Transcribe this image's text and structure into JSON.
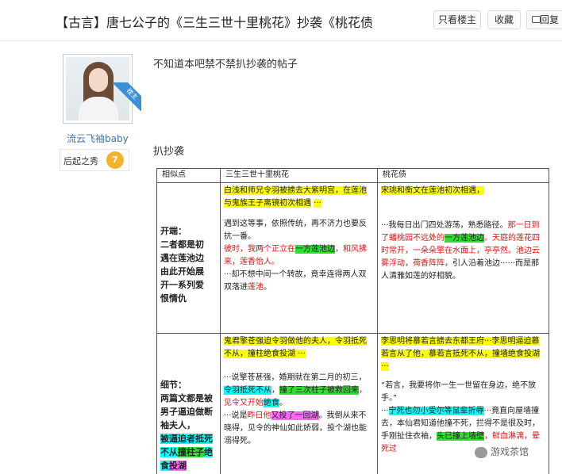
{
  "header": {
    "title": "【古言】唐七公子的《三生三世十里桃花》抄袭《桃花债...",
    "btn_only_op": "只看楼主",
    "btn_fav": "收藏",
    "btn_reply": "回复"
  },
  "user": {
    "ribbon": "楼主",
    "name": "流云飞袖baby",
    "rank": "后起之秀",
    "level": "7"
  },
  "post": {
    "line1": "不知道本吧禁不禁扒抄袭的帖子",
    "line2": "扒抄袭"
  },
  "table": {
    "headers": [
      "相似点",
      "三生三世十里桃花",
      "桃花债"
    ],
    "r1_label": [
      "开端：",
      "二者都是初",
      "遇在莲池边",
      "由此开始展",
      "开一系列爱",
      "恨情仇"
    ],
    "r1_c2_a": "白浅和师兄令羽被掳去大紫明宫，在莲池与鬼族王子离镜初次相遇",
    "r1_c2_a_end": "···",
    "r1_c2_b": "遇到这等事，依照传统，再不济力也要反抗一番。",
    "r1_c2_c1": "彼时，我两个正立在",
    "r1_c2_c2": "一方莲池边",
    "r1_c2_c3": "，和风拂来，莲香怡人。",
    "r1_c2_d1": "···却不想中间一个转故，竟幸连得两人双双落进",
    "r1_c2_d2": "莲池",
    "r1_c2_d3": "。",
    "r1_c3_a": "宋珧和衡文在莲池初次相遇，",
    "r1_c3_b1": "···我每日出门四处游荡，熟悉路径。",
    "r1_c3_b2": "那一日到了蟠桃园不远处的",
    "r1_c3_b3": "一方莲池边",
    "r1_c3_b4": "。天庭的莲花四时常开，一朵朵擎在水面上，亭亭然。池边云雾浮动，荷香阵阵，",
    "r1_c3_b5": "引人沿着池边······而是那人清雅如莲的好相貌。",
    "r2_label1": "细节：",
    "r2_label2": "两篇文都是被男子逼迫做断袖夫人，",
    "r2_label3": "被逼迫者抵死不从",
    "r2_label4": "撞柱",
    "r2_label5": "子",
    "r2_label6": "绝食",
    "r2_label7": "投湖",
    "r2_c2_a": "鬼君擎苍强迫令羽做他的夫人，令羽抵死不从，撞柱绝食投湖 ···",
    "r2_c2_b1": "···说擎苍甚强，婚期就在第二月的初三，",
    "r2_c2_b2": "令羽抵死不从",
    "r2_c2_b3": "，",
    "r2_c2_b4": "撞了三次柱子被救回来",
    "r2_c2_b5": "，见令又开始",
    "r2_c2_b6": "绝食",
    "r2_c2_b7": "。",
    "r2_c2_c1": "···说是",
    "r2_c2_c2": "昨日他",
    "r2_c2_c3": "又投了一回湖",
    "r2_c2_c4": "。我倒从来不晓得，见令的神仙如此娇弱，投个湖也能溺得死。",
    "r2_c3_a": "李思明将慕若言掳去东都王府···李思明逼迫慕若言从了他，慕若言抵死不从，撞墙绝食投湖 ···",
    "r2_c3_b": "“若言，我要将你一生一世留在身边，绝不放手。”",
    "r2_c3_c1": "···",
    "r2_c3_c2": "宁死也勿小受尔等鼠辈折辱",
    "r2_c3_c3": "···竟直向屋墙撞去，本仙君知道他撞不死，拦得不是很及时，手刚扯住衣袖，",
    "r2_c3_c4": "头已撞上墙壁",
    "r2_c3_c5": "，鲜血淋漓，晕死过"
  },
  "watermark": "游戏茶馆"
}
